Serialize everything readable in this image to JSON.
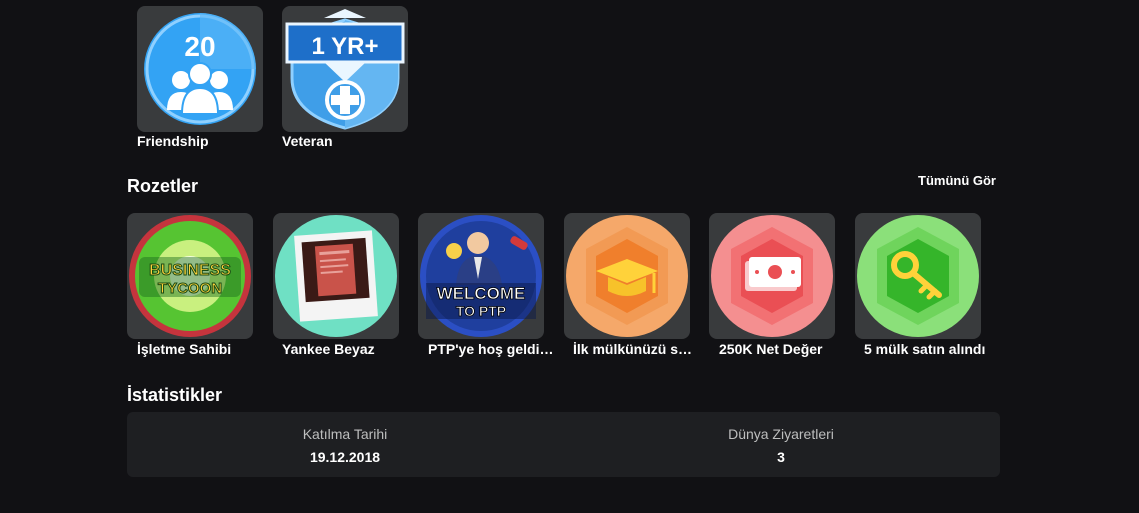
{
  "roblox_badges": [
    {
      "label": "Friendship",
      "number": "20",
      "icon": "friends-icon",
      "color": "#38a9f5"
    },
    {
      "label": "Veteran",
      "banner": "1 YR+",
      "icon": "veteran-shield-icon",
      "color": "#1e6fc9"
    }
  ],
  "badges_section": {
    "title": "Rozetler",
    "see_all": "Tümünü Gör",
    "items": [
      {
        "label": "İşletme Sahibi",
        "art_text": [
          "BUSINESS",
          "TYCOON"
        ],
        "icon": "business-tycoon-icon"
      },
      {
        "label": "Yankee Beyaz",
        "icon": "polaroid-photo-icon"
      },
      {
        "label": "PTP'ye hoş geldiniz",
        "art_text": [
          "WELCOME",
          "TO PTP"
        ],
        "icon": "welcome-ptp-icon"
      },
      {
        "label": "İlk mülkünüzü satın aldınız",
        "icon": "graduation-cap-icon"
      },
      {
        "label": "250K Net Değer",
        "icon": "cash-icon"
      },
      {
        "label": "5 mülk satın alındı",
        "icon": "key-icon"
      }
    ]
  },
  "stats_section": {
    "title": "İstatistikler",
    "items": [
      {
        "label": "Katılma Tarihi",
        "value": "19.12.2018"
      },
      {
        "label": "Dünya Ziyaretleri",
        "value": "3"
      }
    ]
  }
}
